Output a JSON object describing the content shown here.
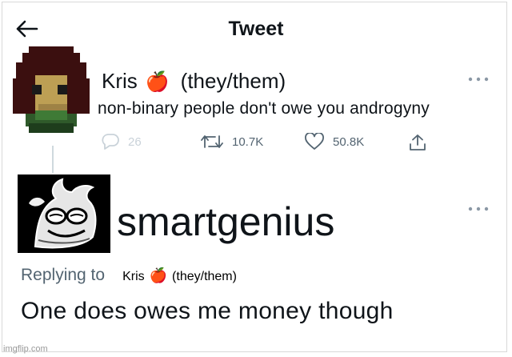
{
  "header": {
    "title": "Tweet"
  },
  "tweet1": {
    "author": "Kris",
    "emoji": "🍎",
    "pronouns": "(they/them)",
    "text": "non-binary people don't owe you androgyny",
    "replies": "26",
    "retweets": "10.7K",
    "likes": "50.8K"
  },
  "tweet2": {
    "author": "smartgenius",
    "replying_label": "Replying to",
    "reply_target_name": "Kris",
    "reply_target_emoji": "🍎",
    "reply_target_pronouns": "(they/them)",
    "text": "One does owes me money though"
  },
  "icons": {
    "back": "arrow-left-icon",
    "more": "more-dots-icon",
    "reply": "reply-bubble-icon",
    "retweet": "retweet-icon",
    "like": "heart-icon",
    "share": "share-icon"
  },
  "colors": {
    "text": "#0f1419",
    "muted": "#536471",
    "line": "#cfd9de"
  },
  "watermark": "imgflip.com"
}
